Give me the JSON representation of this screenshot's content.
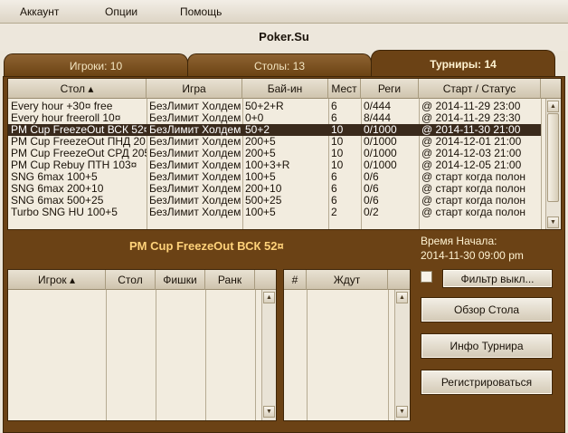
{
  "menu": {
    "items": [
      "Аккаунт",
      "Опции",
      "Помощь"
    ]
  },
  "app": {
    "title": "Poker.Su"
  },
  "tabs": [
    {
      "label": "Игроки: 10",
      "active": false
    },
    {
      "label": "Столы: 13",
      "active": false
    },
    {
      "label": "Турниры: 14",
      "active": true
    }
  ],
  "tournaments": {
    "columns": [
      "Стол ▴",
      "Игра",
      "Бай-ин",
      "Мест",
      "Реги",
      "Старт / Статус"
    ],
    "selected_index": 2,
    "rows": [
      [
        "Every hour +30¤ free",
        "БезЛимит Холдем",
        "50+2+R",
        "6",
        "0/444",
        "@ 2014-11-29 23:00"
      ],
      [
        "Every hour freeroll 10¤",
        "БезЛимит Холдем",
        "0+0",
        "6",
        "8/444",
        "@ 2014-11-29 23:30"
      ],
      [
        "PM Cup FreezeOut ВСК 52¤",
        "БезЛимит Холдем",
        "50+2",
        "10",
        "0/1000",
        "@ 2014-11-30 21:00"
      ],
      [
        "PM Cup FreezeOut ПНД 20",
        "БезЛимит Холдем",
        "200+5",
        "10",
        "0/1000",
        "@ 2014-12-01 21:00"
      ],
      [
        "PM Cup FreezeOut СРД 205",
        "БезЛимит Холдем",
        "200+5",
        "10",
        "0/1000",
        "@ 2014-12-03 21:00"
      ],
      [
        "PM Cup Rebuy ПТН 103¤",
        "БезЛимит Холдем",
        "100+3+R",
        "10",
        "0/1000",
        "@ 2014-12-05 21:00"
      ],
      [
        "SNG 6max 100+5",
        "БезЛимит Холдем",
        "100+5",
        "6",
        "0/6",
        "@ старт когда полон"
      ],
      [
        "SNG 6max 200+10",
        "БезЛимит Холдем",
        "200+10",
        "6",
        "0/6",
        "@ старт когда полон"
      ],
      [
        "SNG 6max 500+25",
        "БезЛимит Холдем",
        "500+25",
        "6",
        "0/6",
        "@ старт когда полон"
      ],
      [
        "Turbo SNG HU 100+5",
        "БезЛимит Холдем",
        "100+5",
        "2",
        "0/2",
        "@ старт когда полон"
      ]
    ]
  },
  "selected": {
    "title": "PM Cup FreezeOut ВСК 52¤",
    "start_label": "Время Начала:",
    "start_value": "2014-11-30 09:00 pm"
  },
  "players_table": {
    "columns": [
      "Игрок ▴",
      "Стол",
      "Фишки",
      "Ранк"
    ]
  },
  "waiting_table": {
    "columns": [
      "#",
      "Ждут"
    ]
  },
  "buttons": {
    "filter": "Фильтр выкл...",
    "table_view": "Обзор Стола",
    "tournament_info": "Инфо Турнира",
    "register": "Регистрироваться"
  }
}
